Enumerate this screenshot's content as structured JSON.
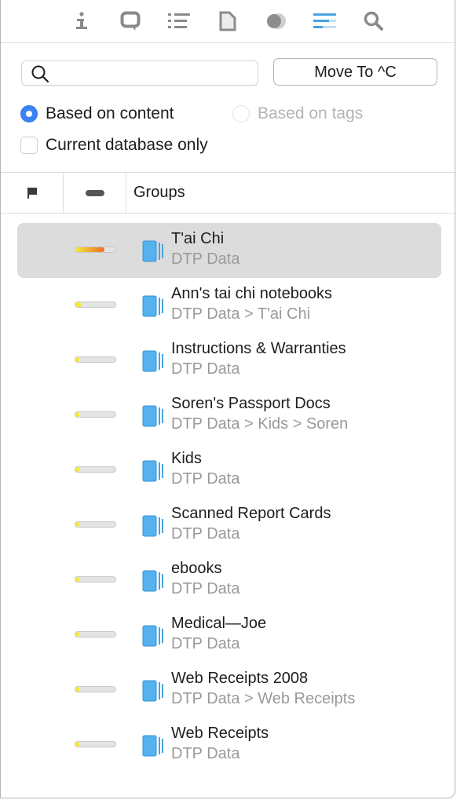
{
  "toolbar": {
    "tools": [
      {
        "icon": "info-icon",
        "label": "Info"
      },
      {
        "icon": "annotation-icon",
        "label": "Annotations"
      },
      {
        "icon": "list-icon",
        "label": "Table of contents"
      },
      {
        "icon": "document-icon",
        "label": "Document"
      },
      {
        "icon": "concordance-icon",
        "label": "Concordance"
      },
      {
        "icon": "see-also-icon",
        "label": "See Also & Classify",
        "active": true
      },
      {
        "icon": "search-icon",
        "label": "Search"
      }
    ],
    "accent_color": "#4aa3df"
  },
  "search": {
    "value": "",
    "placeholder": ""
  },
  "move_button": {
    "label": "Move To ^C"
  },
  "options": {
    "radio_content": {
      "label": "Based on content",
      "selected": true
    },
    "radio_tags": {
      "label": "Based on tags",
      "selected": false,
      "disabled": true
    },
    "checkbox_current_db": {
      "label": "Current database only",
      "checked": false
    }
  },
  "table_header": {
    "flag_icon": "flag-icon",
    "score_icon": "score-icon",
    "groups_label": "Groups"
  },
  "rows": [
    {
      "title": "T'ai Chi",
      "path": "DTP Data",
      "score": 0.72,
      "selected": true
    },
    {
      "title": "Ann's tai chi notebooks",
      "path": "DTP Data > T'ai Chi",
      "score": 0.15,
      "selected": false
    },
    {
      "title": "Instructions & Warranties",
      "path": "DTP Data",
      "score": 0.1,
      "selected": false
    },
    {
      "title": "Soren's Passport Docs",
      "path": "DTP Data > Kids > Soren",
      "score": 0.1,
      "selected": false
    },
    {
      "title": "Kids",
      "path": "DTP Data",
      "score": 0.1,
      "selected": false
    },
    {
      "title": "Scanned Report Cards",
      "path": "DTP Data",
      "score": 0.1,
      "selected": false
    },
    {
      "title": "ebooks",
      "path": "DTP Data",
      "score": 0.1,
      "selected": false
    },
    {
      "title": "Medical—Joe",
      "path": "DTP Data",
      "score": 0.1,
      "selected": false
    },
    {
      "title": "Web Receipts 2008",
      "path": "DTP Data > Web Receipts",
      "score": 0.1,
      "selected": false
    },
    {
      "title": "Web Receipts",
      "path": "DTP Data",
      "score": 0.1,
      "selected": false
    }
  ],
  "colors": {
    "radio_selected": "#3b82f6",
    "score_low": "#f5e93a",
    "score_high": "#f06a2a",
    "group_icon": "#4ea8e6",
    "selection_bg": "#dcdcdc"
  }
}
